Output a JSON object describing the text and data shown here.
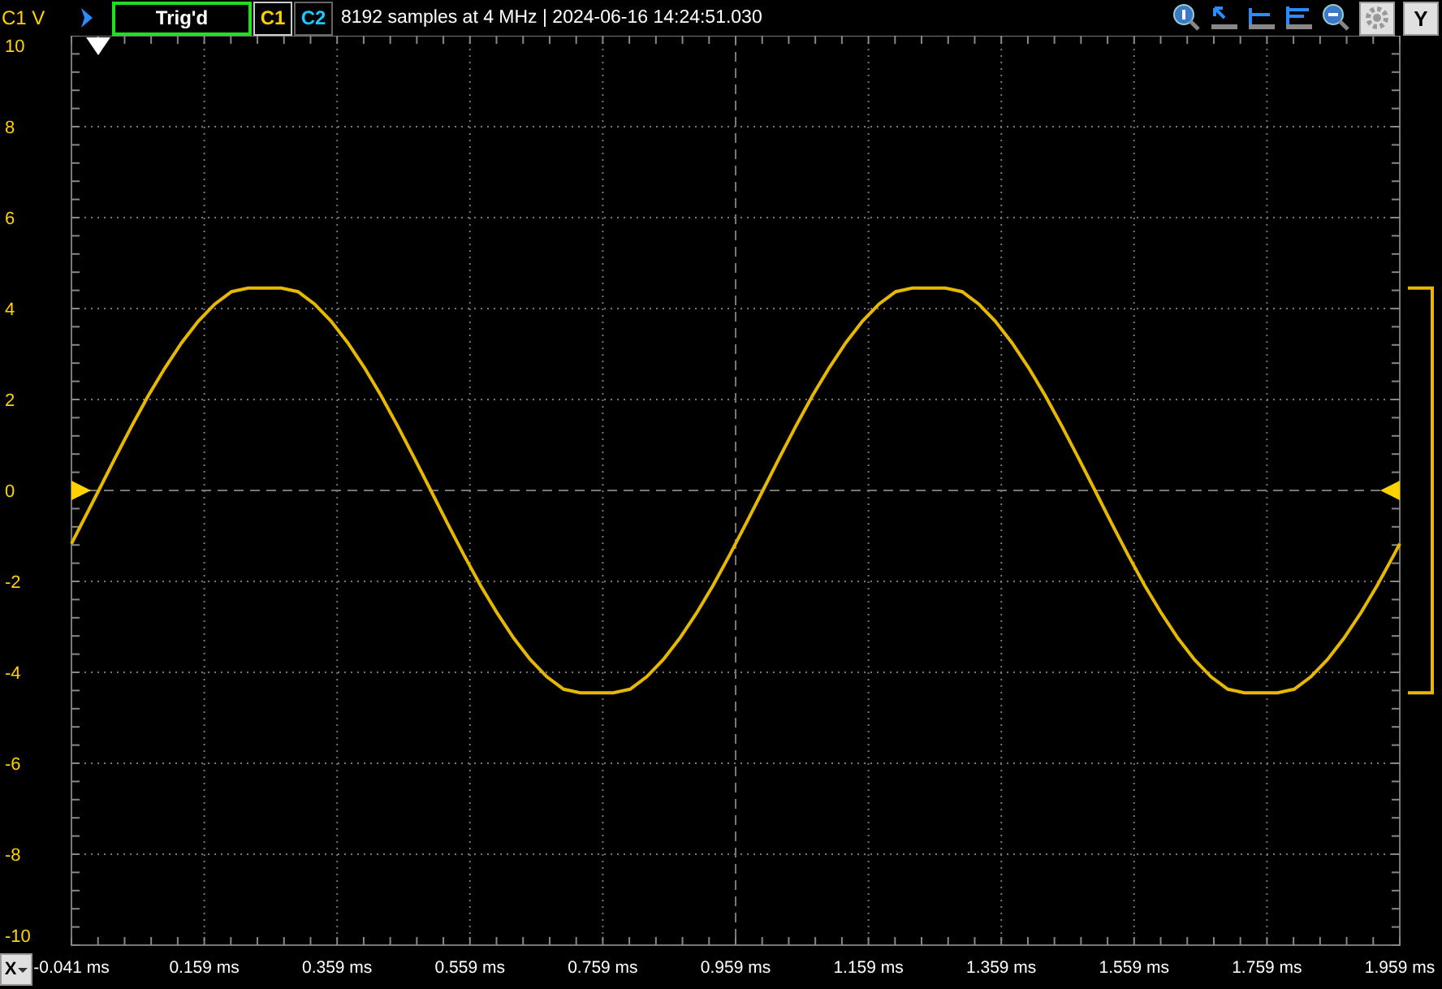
{
  "toolbar": {
    "trigger_status": "Trig'd",
    "channels": [
      {
        "label": "C1",
        "color": "#ffd200",
        "selected": true
      },
      {
        "label": "C2",
        "color": "#1ec8ff",
        "selected": false
      }
    ],
    "info": "8192 samples at 4 MHz | 2024-06-16 14:24:51.030",
    "y_button": "Y"
  },
  "x_button": "X",
  "plot": {
    "chart_data": {
      "type": "line",
      "grid": true,
      "ylabel": "C1 V",
      "xlim": [
        -0.041,
        1.959
      ],
      "ylim": [
        -10,
        10
      ],
      "yticks": [
        -10,
        -8,
        -6,
        -4,
        -2,
        0,
        2,
        4,
        6,
        8,
        10
      ],
      "xticks": [
        {
          "value": -0.041,
          "label": "-0.041 ms"
        },
        {
          "value": 0.159,
          "label": "0.159 ms"
        },
        {
          "value": 0.359,
          "label": "0.359 ms"
        },
        {
          "value": 0.559,
          "label": "0.559 ms"
        },
        {
          "value": 0.759,
          "label": "0.759 ms"
        },
        {
          "value": 0.959,
          "label": "0.959 ms"
        },
        {
          "value": 1.159,
          "label": "1.159 ms"
        },
        {
          "value": 1.359,
          "label": "1.359 ms"
        },
        {
          "value": 1.559,
          "label": "1.559 ms"
        },
        {
          "value": 1.759,
          "label": "1.759 ms"
        },
        {
          "value": 1.959,
          "label": "1.959 ms"
        }
      ],
      "x": [
        -0.041,
        0,
        0.025,
        0.05,
        0.075,
        0.1,
        0.125,
        0.15,
        0.175,
        0.2,
        0.225,
        0.25,
        0.275,
        0.3,
        0.325,
        0.35,
        0.375,
        0.4,
        0.425,
        0.45,
        0.475,
        0.5,
        0.525,
        0.55,
        0.575,
        0.6,
        0.625,
        0.65,
        0.675,
        0.7,
        0.725,
        0.75,
        0.775,
        0.8,
        0.825,
        0.85,
        0.875,
        0.9,
        0.925,
        0.95,
        0.975,
        1,
        1.025,
        1.05,
        1.075,
        1.1,
        1.125,
        1.15,
        1.175,
        1.2,
        1.225,
        1.25,
        1.275,
        1.3,
        1.325,
        1.35,
        1.375,
        1.4,
        1.425,
        1.45,
        1.475,
        1.5,
        1.525,
        1.55,
        1.575,
        1.6,
        1.625,
        1.65,
        1.675,
        1.7,
        1.725,
        1.75,
        1.775,
        1.8,
        1.825,
        1.85,
        1.875,
        1.9,
        1.925,
        1.95,
        1.959
      ],
      "series": [
        {
          "color": "#e6b800",
          "values": [
            -1.17,
            0,
            0.72,
            1.42,
            2.09,
            2.7,
            3.25,
            3.72,
            4.1,
            4.37,
            4.45,
            4.45,
            4.45,
            4.37,
            4.1,
            3.72,
            3.25,
            2.7,
            2.09,
            1.42,
            0.72,
            0,
            -0.72,
            -1.42,
            -2.09,
            -2.7,
            -3.25,
            -3.72,
            -4.1,
            -4.37,
            -4.45,
            -4.45,
            -4.45,
            -4.37,
            -4.1,
            -3.72,
            -3.25,
            -2.7,
            -2.09,
            -1.42,
            -0.72,
            0,
            0.72,
            1.42,
            2.09,
            2.7,
            3.25,
            3.72,
            4.1,
            4.37,
            4.45,
            4.45,
            4.45,
            4.37,
            4.1,
            3.72,
            3.25,
            2.7,
            2.09,
            1.42,
            0.72,
            0,
            -0.72,
            -1.42,
            -2.09,
            -2.7,
            -3.25,
            -3.72,
            -4.1,
            -4.37,
            -4.45,
            -4.45,
            -4.45,
            -4.37,
            -4.1,
            -3.72,
            -3.25,
            -2.7,
            -2.09,
            -1.42,
            -1.17
          ]
        }
      ]
    }
  }
}
